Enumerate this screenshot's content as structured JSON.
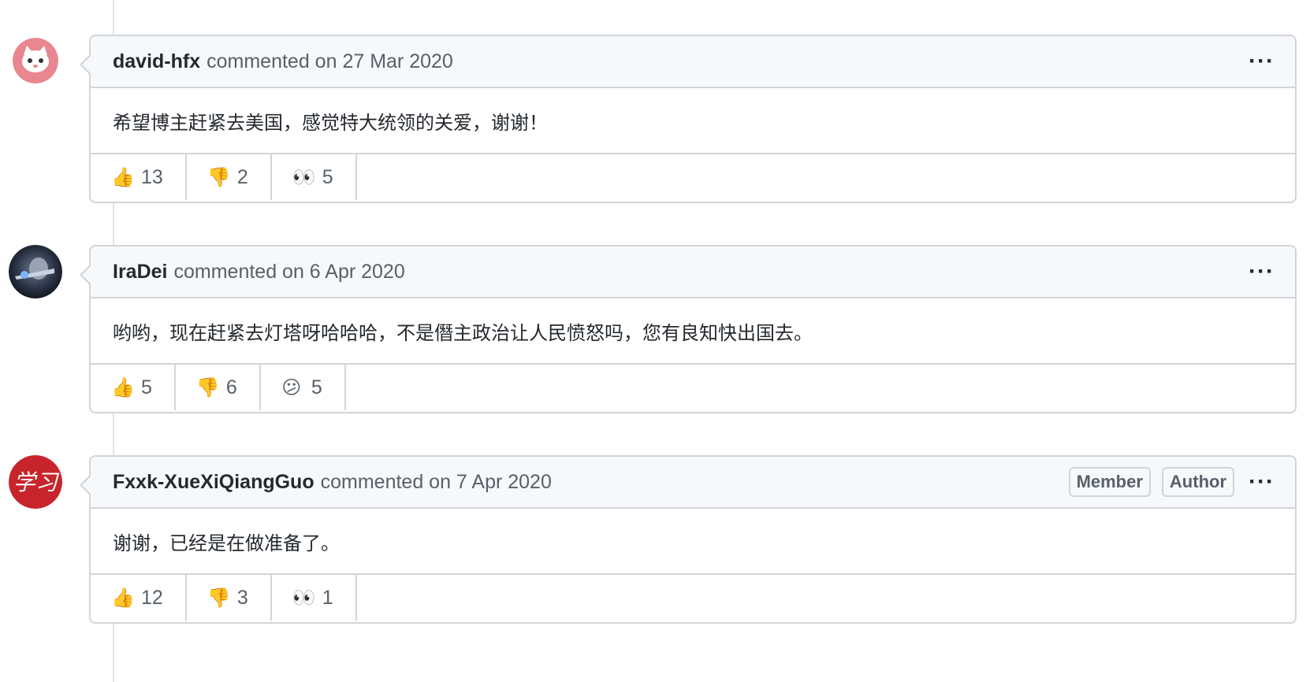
{
  "comments": [
    {
      "author": "david-hfx",
      "meta": "commented on 27 Mar 2020",
      "body": "希望博主赶紧去美国，感觉特大统领的关爱，谢谢！",
      "labels": [],
      "reactions": [
        {
          "icon": "thumbs-up-icon",
          "emoji": "👍",
          "count": "13"
        },
        {
          "icon": "thumbs-down-icon",
          "emoji": "👎",
          "count": "2"
        },
        {
          "icon": "eyes-icon",
          "emoji": "👀",
          "count": "5"
        }
      ]
    },
    {
      "author": "IraDei",
      "meta": "commented on 6 Apr 2020",
      "body": "哟哟，现在赶紧去灯塔呀哈哈哈，不是僭主政治让人民愤怒吗，您有良知快出国去。",
      "labels": [],
      "reactions": [
        {
          "icon": "thumbs-up-icon",
          "emoji": "👍",
          "count": "5"
        },
        {
          "icon": "thumbs-down-icon",
          "emoji": "👎",
          "count": "6"
        },
        {
          "icon": "confused-icon",
          "emoji": "😕",
          "count": "5"
        }
      ]
    },
    {
      "author": "Fxxk-XueXiQiangGuo",
      "meta": "commented on 7 Apr 2020",
      "body": "谢谢，已经是在做准备了。",
      "labels": [
        "Member",
        "Author"
      ],
      "reactions": [
        {
          "icon": "thumbs-up-icon",
          "emoji": "👍",
          "count": "12"
        },
        {
          "icon": "thumbs-down-icon",
          "emoji": "👎",
          "count": "3"
        },
        {
          "icon": "eyes-icon",
          "emoji": "👀",
          "count": "1"
        }
      ]
    }
  ],
  "kebab": "···",
  "avatar_logo_text": "学习"
}
